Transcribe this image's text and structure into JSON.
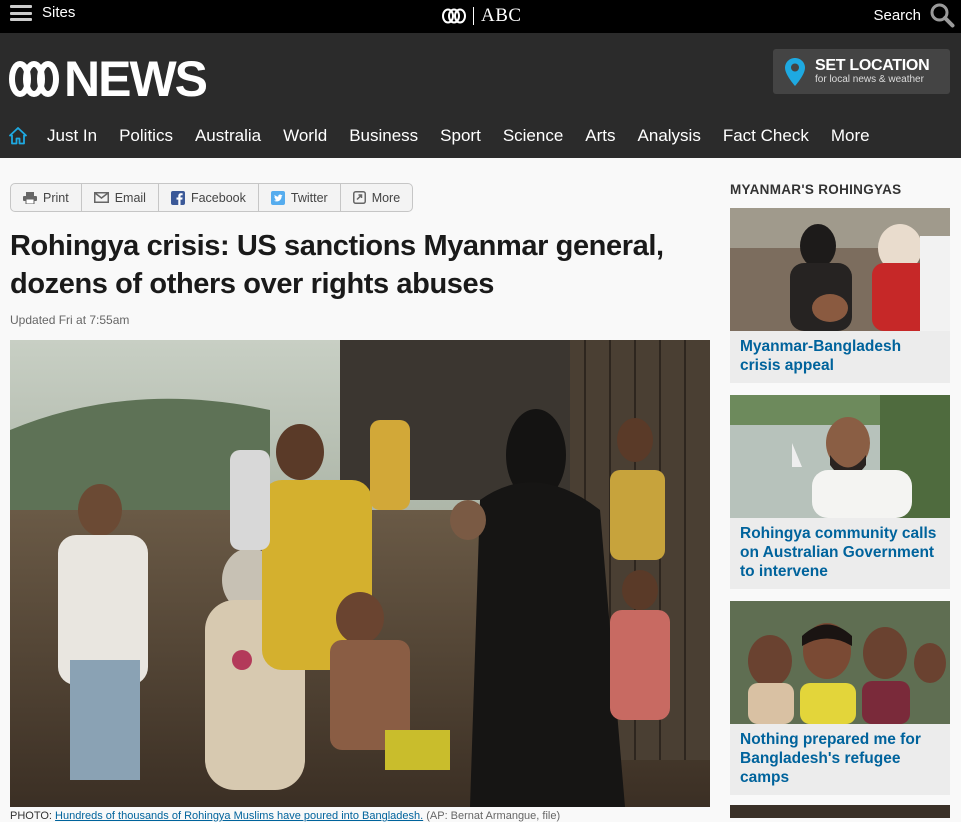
{
  "topbar": {
    "sites_label": "Sites",
    "abc_label": "ABC",
    "search_label": "Search"
  },
  "header": {
    "logo_text": "NEWS",
    "set_location": {
      "title": "SET LOCATION",
      "subtitle": "for local news & weather"
    }
  },
  "nav": {
    "items": [
      "Just In",
      "Politics",
      "Australia",
      "World",
      "Business",
      "Sport",
      "Science",
      "Arts",
      "Analysis",
      "Fact Check",
      "More"
    ]
  },
  "share": {
    "print": "Print",
    "email": "Email",
    "facebook": "Facebook",
    "twitter": "Twitter",
    "more": "More"
  },
  "article": {
    "headline": "Rohingya crisis: US sanctions Myanmar general, dozens of others over rights abuses",
    "updated": "Updated Fri at 7:55am",
    "caption_label": "PHOTO:",
    "caption_text": "Hundreds of thousands of Rohingya Muslims have poured into Bangladesh.",
    "caption_credit": "(AP: Bernat Armangue, file)"
  },
  "sidebar": {
    "title": "MYANMAR'S ROHINGYAS",
    "cards": [
      {
        "title": "Myanmar-Bangladesh crisis appeal"
      },
      {
        "title": "Rohingya community calls on Australian Government to intervene"
      },
      {
        "title": "Nothing prepared me for Bangladesh's refugee camps"
      }
    ]
  },
  "colors": {
    "accent": "#00639c",
    "header_bg": "#2b2b2b",
    "location_pin": "#1ea9e1"
  }
}
